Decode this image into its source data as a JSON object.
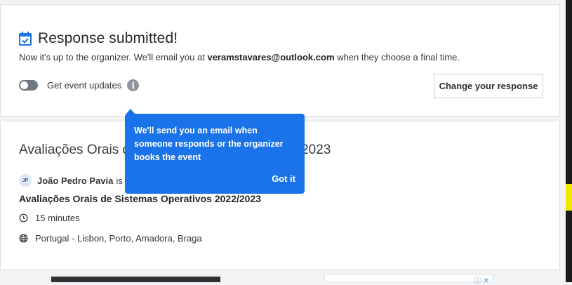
{
  "confirmation": {
    "title": "Response submitted!",
    "notice_prefix": "Now it's up to the organizer. We'll email you at ",
    "email": "veramstavares@outlook.com",
    "notice_suffix": " when they choose a final time.",
    "toggle_label": "Get event updates",
    "toggle_on": false,
    "info_glyph": "i",
    "change_button": "Change your response"
  },
  "event": {
    "title_left": "Avaliações Orais d",
    "title_right": "2023",
    "organizer_initials": "JP",
    "organizer_name": "João Pedro Pavia",
    "organizer_suffix": "is or",
    "poll_name": "Avaliações Orais de Sistemas Operativos 2022/2023",
    "duration": "15 minutes",
    "location": "Portugal - Lisbon, Porto, Amadora, Braga"
  },
  "tooltip": {
    "message": "We'll send you an email when someone responds or the organizer books the event",
    "dismiss": "Got it"
  },
  "ads": {
    "right_icons": "ⓘ ✕"
  },
  "colors": {
    "accent": "#1a73e8",
    "toggle_off": "#707781",
    "strip_yellow": "#f5e600"
  },
  "icons": [
    "calendar-check-icon",
    "info-icon",
    "clock-icon",
    "globe-icon"
  ]
}
